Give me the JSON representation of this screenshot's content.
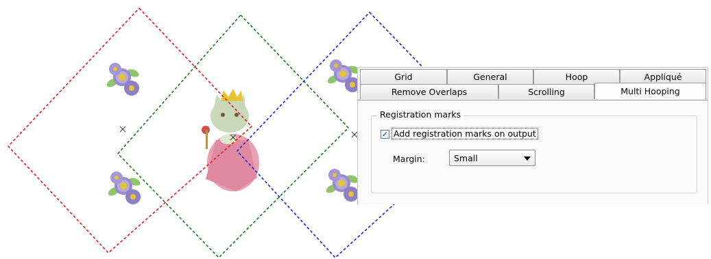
{
  "colors": {
    "hoop_red": "#e21b1b",
    "hoop_green": "#137a13",
    "hoop_blue": "#1d1de0"
  },
  "hoops": [
    {
      "name": "red-hoop",
      "color": "#e21b1b"
    },
    {
      "name": "green-hoop",
      "color": "#137a13"
    },
    {
      "name": "blue-hoop",
      "color": "#1d1de0"
    }
  ],
  "design": {
    "motifs": [
      "flower-cluster",
      "cat-princess"
    ]
  },
  "dialog": {
    "tabs_row1": [
      "Grid",
      "General",
      "Hoop",
      "Appliqué"
    ],
    "tabs_row2": [
      "Remove Overlaps",
      "Scrolling",
      "Multi Hooping"
    ],
    "active_tab": "Multi Hooping",
    "group_title": "Registration marks",
    "checkbox_label": "Add registration marks on output",
    "checkbox_checked": true,
    "checkbox_mark": "✓",
    "margin_label": "Margin:",
    "margin_value": "Small"
  }
}
